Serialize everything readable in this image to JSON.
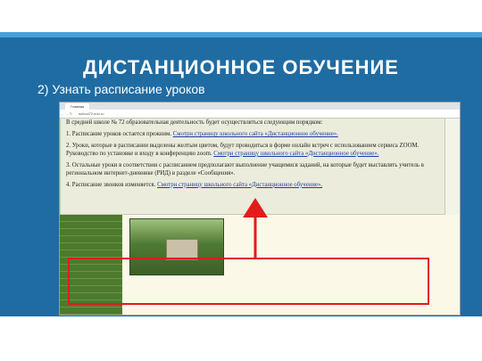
{
  "slide": {
    "title": "ДИСТАНЦИОННОЕ ОБУЧЕНИЕ",
    "subtitle": "2) Узнать расписание уроков",
    "colors": {
      "band": "#1f6ca3",
      "highlight": "#e21b1b"
    }
  },
  "browser": {
    "tab_label": "Главная",
    "url": "school72.edu.ru"
  },
  "notice": {
    "intro": "В средней школе № 72 образовательная деятельность будет осуществляться следующим порядком:",
    "item1_text": "1. Расписание уроков остается прежним. ",
    "item1_link": "Смотри страницу школьного сайта «Дистанционное обучение».",
    "item2_text": "2. Уроки, которые в расписании выделены желтым цветом, будут проводиться в форме онлайн встреч с использованием сервиса ZOOM. Руководство по установке и входу в конференцию zoom. ",
    "item2_link": "Смотри страницу школьного сайта «Дистанционное обучение».",
    "item3_text": "3. Остальные уроки в соответствии с расписанием предполагают выполнение учащимися заданий, на которые будет выставлять учитель в региональном интернет-дневнике (РИД) в разделе «Сообщения».",
    "item4_text": "4. Расписание звонков изменяется. ",
    "item4_link": "Смотри страницу школьного сайта «Дистанционное обучение»."
  }
}
